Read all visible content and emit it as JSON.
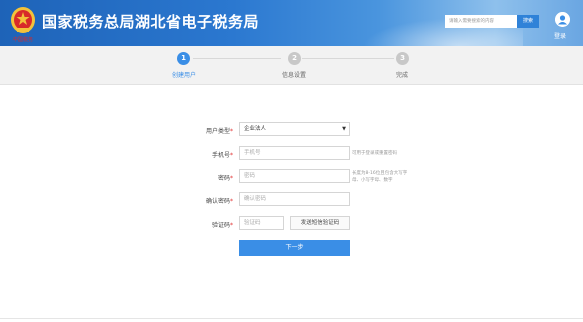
{
  "header": {
    "site_title": "国家税务总局湖北省电子税务局",
    "emblem_subtitle": "中国税务",
    "search_placeholder": "请输入需要搜索的内容",
    "search_button": "搜索",
    "login_label": "登录"
  },
  "steps": [
    {
      "number": "1",
      "label": "创建用户",
      "active": true
    },
    {
      "number": "2",
      "label": "信息设置",
      "active": false
    },
    {
      "number": "3",
      "label": "完成",
      "active": false
    }
  ],
  "form": {
    "user_type": {
      "label": "用户类型",
      "value": "企业法人"
    },
    "phone": {
      "label": "手机号",
      "placeholder": "手机号",
      "hint": "可用于登录或重置密码"
    },
    "password": {
      "label": "密码",
      "placeholder": "密码",
      "hint": "长度为8-16位且包含大写字母、小写字母、数字"
    },
    "confirm_password": {
      "label": "确认密码",
      "placeholder": "确认密码"
    },
    "captcha": {
      "label": "验证码",
      "placeholder": "验证码",
      "send_button": "发送短信验证码"
    },
    "next_button": "下一步"
  },
  "colors": {
    "primary": "#3a8ee6",
    "required": "#e03030"
  }
}
